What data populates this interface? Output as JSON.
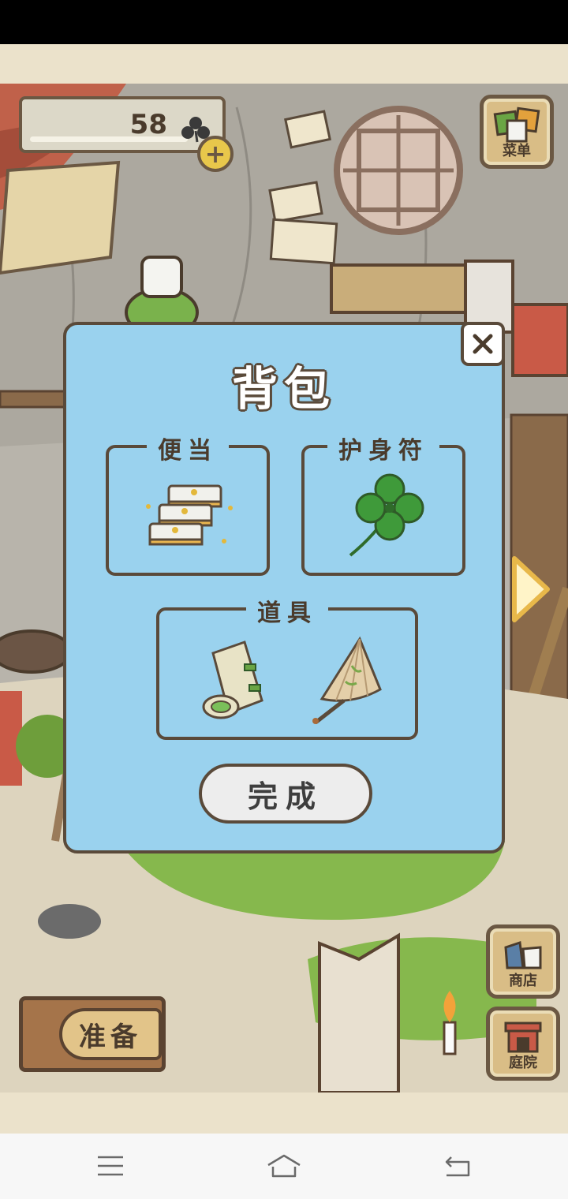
{
  "hud": {
    "clover_count": "58",
    "menu_label": "菜单",
    "shop_label": "商店",
    "garden_label": "庭院",
    "prepare_label": "准备"
  },
  "backpack": {
    "title": "背包",
    "slots": [
      {
        "label": "便当",
        "item": "bento-icon"
      },
      {
        "label": "护身符",
        "item": "four-leaf-clover-icon"
      },
      {
        "label": "道具",
        "items": [
          "rolled-mat-icon",
          "paper-umbrella-icon"
        ]
      }
    ],
    "done_label": "完成"
  },
  "colors": {
    "panel": "#9ad2ee",
    "border": "#5a4a3a",
    "beige": "#ebe2cb",
    "button_wood": "#d9bd86"
  }
}
